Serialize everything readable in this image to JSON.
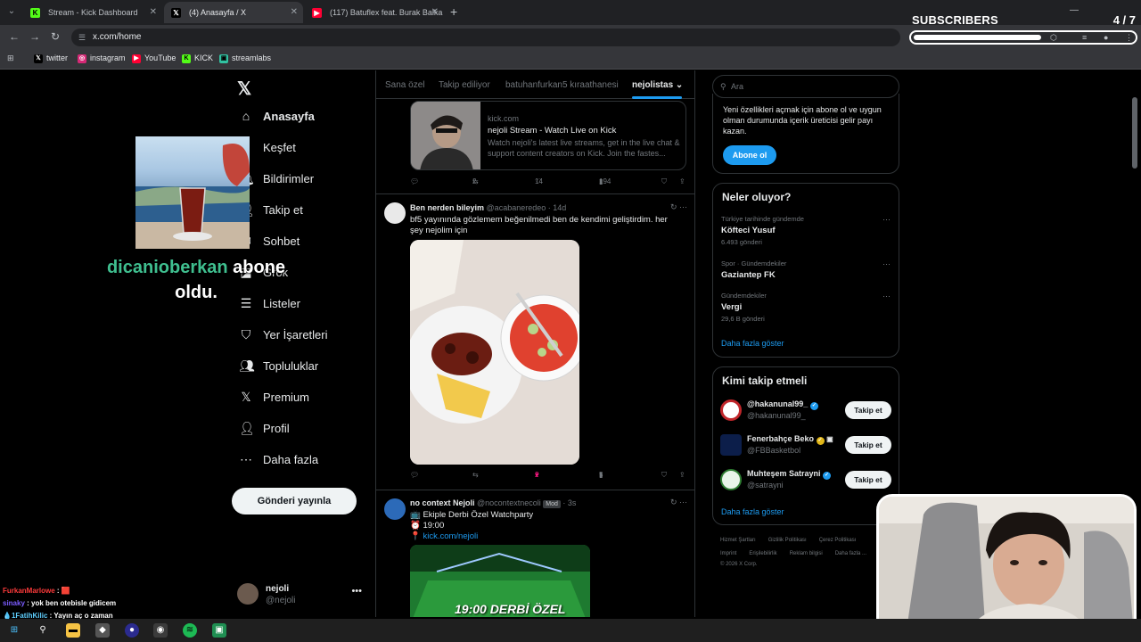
{
  "browser": {
    "tabs": [
      {
        "title": "Stream - Kick Dashboard",
        "favicon": "kick-icon",
        "active": false
      },
      {
        "title": "(4) Anasayfa / X",
        "favicon": "x-icon",
        "active": true
      },
      {
        "title": "(117) Batuflex feat. Burak Balka",
        "favicon": "youtube-icon",
        "active": false
      }
    ],
    "url": "x.com/home",
    "bookmarks": [
      {
        "label": "twitter",
        "icon": "x-icon"
      },
      {
        "label": "instagram",
        "icon": "instagram-icon"
      },
      {
        "label": "YouTube",
        "icon": "youtube-icon"
      },
      {
        "label": "KICK",
        "icon": "kick-icon"
      },
      {
        "label": "streamlabs",
        "icon": "streamlabs-icon"
      }
    ]
  },
  "subscribers": {
    "label": "SUBSCRIBERS",
    "count": "4 / 7",
    "progress": 0.57
  },
  "nav": {
    "items": [
      {
        "label": "Anasayfa",
        "icon": "home-icon"
      },
      {
        "label": "Keşfet",
        "icon": "search-icon"
      },
      {
        "label": "Bildirimler",
        "icon": "bell-icon"
      },
      {
        "label": "Takip et",
        "icon": "follow-icon"
      },
      {
        "label": "Sohbet",
        "icon": "chat-icon"
      },
      {
        "label": "Grok",
        "icon": "grok-icon"
      },
      {
        "label": "Listeler",
        "icon": "list-icon"
      },
      {
        "label": "Yer İşaretleri",
        "icon": "bookmark-icon"
      },
      {
        "label": "Topluluklar",
        "icon": "communities-icon"
      },
      {
        "label": "Premium",
        "icon": "x-icon"
      },
      {
        "label": "Profil",
        "icon": "profile-icon"
      },
      {
        "label": "Daha fazla",
        "icon": "more-icon"
      }
    ],
    "post_button": "Gönderi yayınla",
    "account": {
      "name": "nejoli",
      "handle": "@nejoli"
    }
  },
  "alert": {
    "user": "dicanioberkan",
    "text1": " abone",
    "text2": "oldu."
  },
  "feed": {
    "tabs": [
      "Sana özel",
      "Takip ediliyor",
      "batuhanfurkan5 kıraathanesi",
      "nejolistas"
    ],
    "card": {
      "domain": "kick.com",
      "title": "nejoli Stream - Watch Live on Kick",
      "desc": "Watch nejoli's latest live streams, get in the live chat & support content creators on Kick. Join the fastes..."
    },
    "card_stats": {
      "retweets": "2",
      "likes": "14",
      "views": "194"
    },
    "tweet1": {
      "name": "Ben nerden bileyim",
      "handle": "@acabaneredeo · 14d",
      "text": "bf5 yayınında gözlemem beğenilmedi ben de kendimi geliştirdim. her şey nejolim için",
      "likes": "2",
      "views": "5"
    },
    "tweet2": {
      "name": "no context Nejoli",
      "handle": "@nocontextnecoli",
      "badge": "Mod",
      "time": "· 3s",
      "line1": "📺 Ekiple Derbi Özel Watchparty",
      "line2": "⏰ 19:00",
      "link": "kick.com/nejoli",
      "video_text": "19:00 DERBİ ÖZEL"
    }
  },
  "right": {
    "search_placeholder": "Ara",
    "premium_text": "Yeni özellikleri açmak için abone ol ve uygun olman durumunda içerik üreticisi gelir payı kazan.",
    "premium_button": "Abone ol",
    "trends_title": "Neler oluyor?",
    "trends": [
      {
        "category": "Türkiye tarihinde gündemde",
        "name": "Köfteci Yusuf",
        "count": "6.493 gönderi"
      },
      {
        "category": "Spor · Gündemdekiler",
        "name": "Gaziantep FK",
        "count": ""
      },
      {
        "category": "Gündemdekiler",
        "name": "Vergi",
        "count": "29,6 B gönderi"
      }
    ],
    "show_more": "Daha fazla göster",
    "wtf_title": "Kimi takip etmeli",
    "wtf": [
      {
        "name": "@hakanunal99_",
        "handle": "@hakanunal99_",
        "badge": "blue"
      },
      {
        "name": "Fenerbahçe Beko",
        "handle": "@FBBasketbol",
        "badge": "gold"
      },
      {
        "name": "Muhteşem Satrayni",
        "handle": "@satrayni",
        "badge": "blue"
      }
    ],
    "follow_label": "Takip et",
    "footer": [
      "Hizmet Şartları",
      "Gizlilik Politikası",
      "Çerez Politikası",
      "Imprint",
      "Erişilebilirlik",
      "Reklam bilgisi",
      "Daha fazla ...",
      "© 2026 X Corp."
    ]
  },
  "chat": [
    {
      "user": "FurkanMarlowe",
      "msg": " : 🟥"
    },
    {
      "user": "sinaky",
      "msg": " : yok ben otebisle gidicem"
    },
    {
      "user": "1FatihKilic",
      "msg": " : Yayın aç o zaman"
    }
  ]
}
